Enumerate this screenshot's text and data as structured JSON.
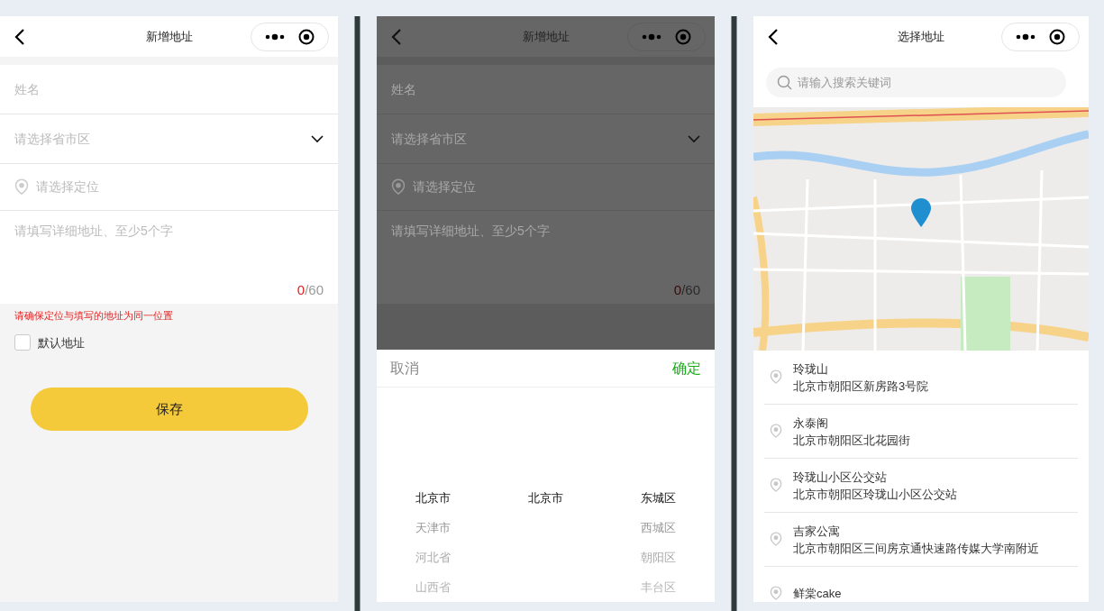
{
  "screens": [
    {
      "kind": "form",
      "dimmed": false,
      "title": "新增地址",
      "fields": [
        {
          "kind": "text",
          "placeholder": "姓名"
        },
        {
          "kind": "select",
          "placeholder": "请选择省市区"
        },
        {
          "kind": "location",
          "placeholder": "请选择定位"
        },
        {
          "kind": "textarea",
          "placeholder": "请填写详细地址、至少5个字",
          "count": "0",
          "max": "/60"
        }
      ],
      "notice": "请确保定位与填写的地址为同一位置",
      "default_address": {
        "label": "默认地址",
        "checked": false
      },
      "save_button": "保存"
    },
    {
      "kind": "form",
      "dimmed": true,
      "title": "新增地址",
      "fields": [
        {
          "kind": "text",
          "placeholder": "姓名"
        },
        {
          "kind": "select",
          "placeholder": "请选择省市区"
        },
        {
          "kind": "location",
          "placeholder": "请选择定位"
        },
        {
          "kind": "textarea",
          "placeholder": "请填写详细地址、至少5个字",
          "count": "0",
          "max": "/60"
        }
      ],
      "picker": {
        "cancel": "取消",
        "confirm": "确定",
        "columns": [
          [
            {
              "label": "北京市",
              "selected": true
            },
            {
              "label": "天津市",
              "selected": false
            },
            {
              "label": "河北省",
              "selected": false
            },
            {
              "label": "山西省",
              "selected": false
            }
          ],
          [
            {
              "label": "北京市",
              "selected": true
            }
          ],
          [
            {
              "label": "东城区",
              "selected": true
            },
            {
              "label": "西城区",
              "selected": false
            },
            {
              "label": "朝阳区",
              "selected": false
            },
            {
              "label": "丰台区",
              "selected": false
            }
          ]
        ]
      }
    },
    {
      "kind": "map",
      "title": "选择地址",
      "search": {
        "placeholder": "请输入搜索关键词"
      },
      "places": [
        {
          "name": "玲珑山",
          "address": "北京市朝阳区新房路3号院"
        },
        {
          "name": "永泰阁",
          "address": "北京市朝阳区北花园街"
        },
        {
          "name": "玲珑山小区公交站",
          "address": "北京市朝阳区玲珑山小区公交站"
        },
        {
          "name": "吉家公寓",
          "address": "北京市朝阳区三间房京通快速路传媒大学南附近"
        },
        {
          "name": "鲜棠cake"
        }
      ]
    }
  ]
}
